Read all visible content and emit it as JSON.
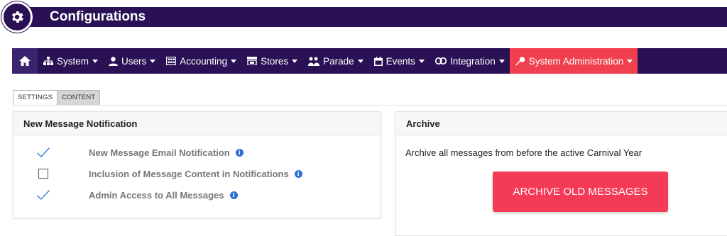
{
  "header": {
    "title": "Configurations",
    "icon": "gear-icon"
  },
  "nav": {
    "home_icon": "home-icon",
    "items": [
      {
        "label": "System",
        "icon": "sitemap-icon"
      },
      {
        "label": "Users",
        "icon": "user-icon"
      },
      {
        "label": "Accounting",
        "icon": "calculator-icon"
      },
      {
        "label": "Stores",
        "icon": "store-icon"
      },
      {
        "label": "Parade",
        "icon": "parade-icon"
      },
      {
        "label": "Events",
        "icon": "calendar-icon"
      },
      {
        "label": "Integration",
        "icon": "link-icon"
      },
      {
        "label": "System Administration",
        "icon": "key-icon",
        "active": true
      }
    ]
  },
  "tabs": [
    {
      "label": "SETTINGS",
      "selected": true
    },
    {
      "label": "CONTENT",
      "selected": false
    }
  ],
  "notification_panel": {
    "title": "New Message Notification",
    "options": [
      {
        "label": "New Message Email Notification",
        "checked": true
      },
      {
        "label": "Inclusion of Message Content in Notifications",
        "checked": false
      },
      {
        "label": "Admin Access to All Messages",
        "checked": true
      }
    ]
  },
  "archive_panel": {
    "title": "Archive",
    "description": "Archive all messages from before the active Carnival Year",
    "button_label": "ARCHIVE OLD MESSAGES"
  },
  "colors": {
    "nav_bg": "#2a1155",
    "active_nav": "#f04050",
    "archive_button": "#f53a55",
    "check": "#3b7fd9",
    "info": "#2b6fd6"
  }
}
